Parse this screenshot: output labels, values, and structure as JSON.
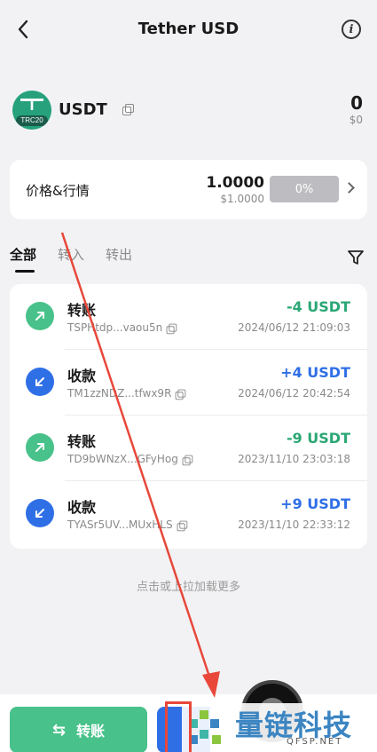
{
  "header": {
    "title": "Tether USD",
    "back_icon": "chevron-left-icon",
    "info_icon": "info-icon"
  },
  "token": {
    "logo_text": "T",
    "logo_tag": "TRC20",
    "name": "USDT",
    "balance": "0",
    "balance_fiat": "$0"
  },
  "price": {
    "label": "价格&行情",
    "value": "1.0000",
    "fiat": "$1.0000",
    "change": "0%"
  },
  "tabs": [
    {
      "label": "全部",
      "active": true
    },
    {
      "label": "转入",
      "active": false
    },
    {
      "label": "转出",
      "active": false
    }
  ],
  "transactions": [
    {
      "type": "转账",
      "direction": "out",
      "address": "TSPHtdp...vaou5n",
      "amount": "-4 USDT",
      "time": "2024/06/12 21:09:03"
    },
    {
      "type": "收款",
      "direction": "in",
      "address": "TM1zzNDZ...tfwx9R",
      "amount": "+4 USDT",
      "time": "2024/06/12 20:42:54"
    },
    {
      "type": "转账",
      "direction": "out",
      "address": "TD9bWNzX...GFyHog",
      "amount": "-9 USDT",
      "time": "2023/11/10 23:03:18"
    },
    {
      "type": "收款",
      "direction": "in",
      "address": "TYASr5UV...MUxHLS",
      "amount": "+9 USDT",
      "time": "2023/11/10 22:33:12"
    }
  ],
  "load_more": "点击或上拉加载更多",
  "bottom": {
    "transfer_label": "转账",
    "transfer_icon": "swap-icon"
  },
  "watermark": {
    "title": "量链科技",
    "subtitle": "QFSP.NET"
  },
  "colors": {
    "green": "#48c28a",
    "blue": "#2f6fe6",
    "annotation_red": "#e8473a"
  }
}
